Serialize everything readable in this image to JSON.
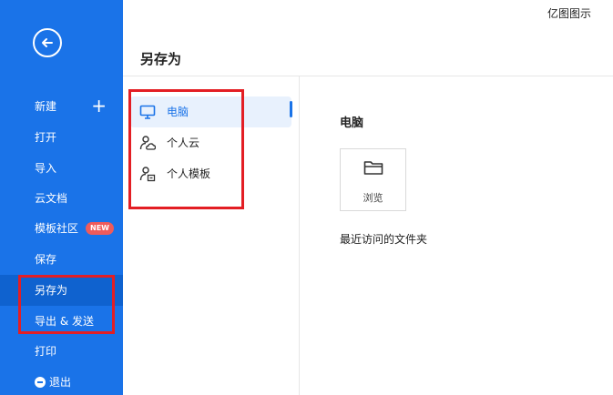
{
  "brand": "亿图图示",
  "page_title": "另存为",
  "sidebar": {
    "items": [
      {
        "label": "新建"
      },
      {
        "label": "打开"
      },
      {
        "label": "导入"
      },
      {
        "label": "云文档"
      },
      {
        "label": "模板社区",
        "badge": "NEW"
      },
      {
        "label": "保存"
      },
      {
        "label": "另存为"
      },
      {
        "label": "导出 & 发送"
      },
      {
        "label": "打印"
      },
      {
        "label": "退出"
      }
    ]
  },
  "locations": [
    {
      "label": "电脑",
      "icon": "monitor-icon"
    },
    {
      "label": "个人云",
      "icon": "user-cloud-icon"
    },
    {
      "label": "个人模板",
      "icon": "user-template-icon"
    }
  ],
  "content": {
    "section_title": "电脑",
    "browse_label": "浏览",
    "recent_label": "最近访问的文件夹"
  },
  "colors": {
    "sidebar_bg": "#1a73e8",
    "sidebar_active": "#0f62cf",
    "accent": "#1a73e8",
    "badge": "#ef5b5b",
    "highlight_box": "#e31e24"
  }
}
